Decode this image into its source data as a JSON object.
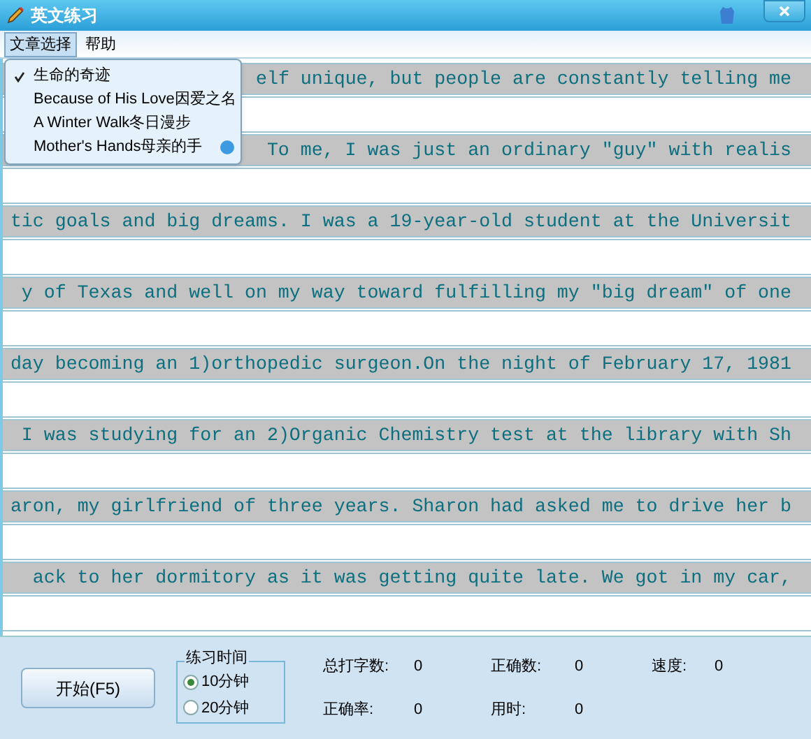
{
  "window": {
    "title": "英文练习"
  },
  "menu_bar": [
    {
      "label": "文章选择",
      "expanded": true
    },
    {
      "label": "帮助",
      "expanded": false
    }
  ],
  "dropdown": [
    {
      "label": "生命的奇迹",
      "checked": true
    },
    {
      "label": "Because of His Love因爱之名",
      "checked": false
    },
    {
      "label": "A Winter Walk冬日漫步",
      "checked": false
    },
    {
      "label": "Mother's Hands母亲的手",
      "checked": false
    }
  ],
  "lines": [
    {
      "text": "elf unique, but people are constantly telling me"
    },
    {
      "text": "To me, I was just an ordinary \"guy\" with realis"
    },
    {
      "text": "tic goals and big dreams. I was a 19-year-old student at the Universit"
    },
    {
      "text": "y of Texas and well on my way toward fulfilling my \"big dream\" of one"
    },
    {
      "text": "day becoming an 1)orthopedic surgeon.On the night of February 17, 1981"
    },
    {
      "text": " I was studying for an 2)Organic Chemistry test at the library with Sh"
    },
    {
      "text": "aron, my girlfriend of three years. Sharon had asked me to drive her b"
    },
    {
      "text": "ack to her dormitory as it was getting quite late. We got in my car,"
    }
  ],
  "start_button": "开始(F5)",
  "practice_time": {
    "title": "练习时间",
    "options": [
      {
        "label": "10分钟",
        "selected": true
      },
      {
        "label": "20分钟",
        "selected": false
      }
    ]
  },
  "stats": [
    {
      "label": "总打字数:",
      "value": "0"
    },
    {
      "label": "正确数:",
      "value": "0"
    },
    {
      "label": "速度:",
      "value": "0"
    },
    {
      "label": "正确率:",
      "value": "0"
    },
    {
      "label": "用时:",
      "value": "0"
    }
  ]
}
